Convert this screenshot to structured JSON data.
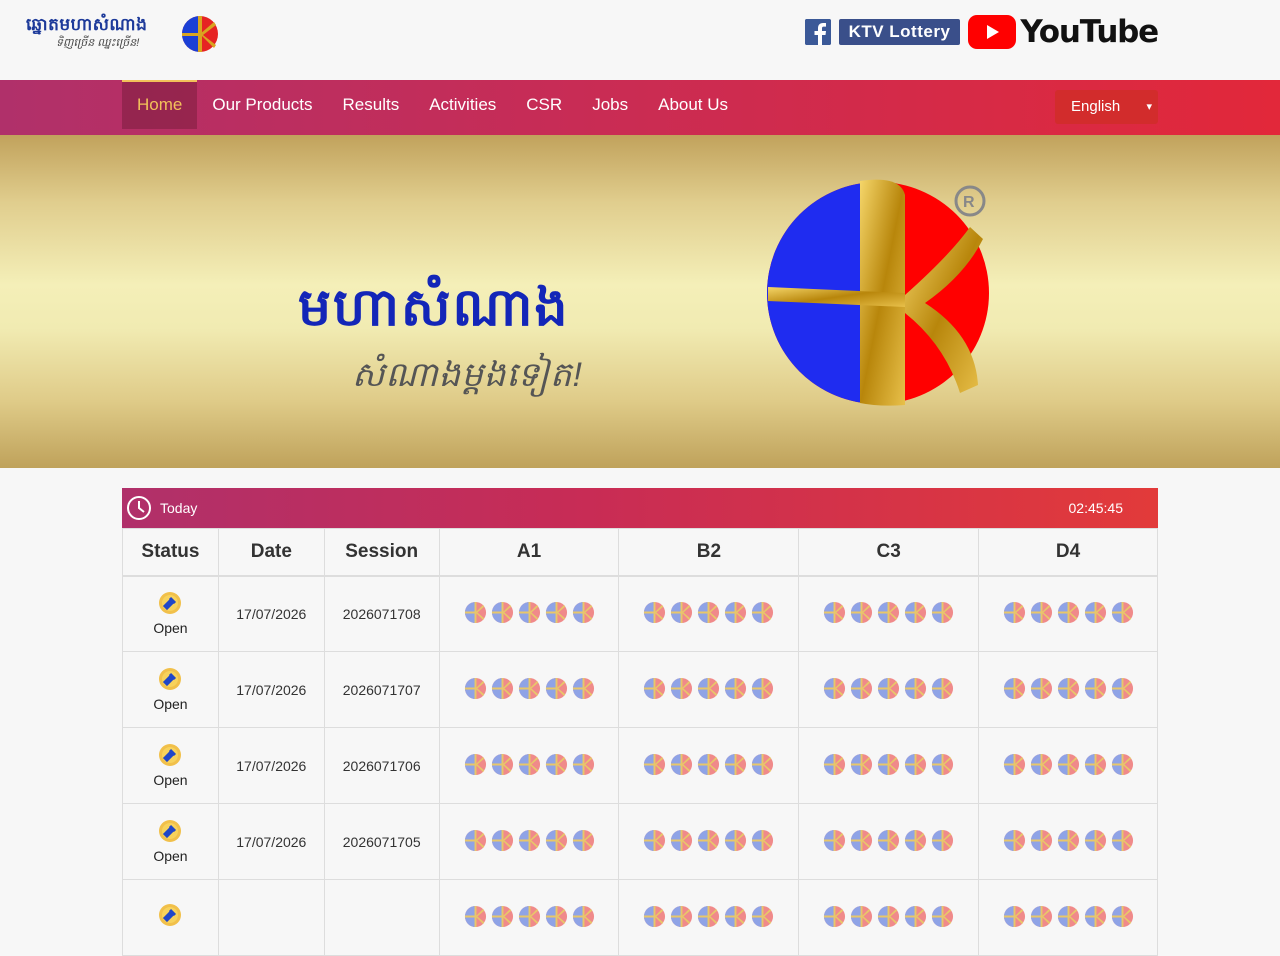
{
  "header": {
    "logo": {
      "title": "ឆ្នោតមហាសំណាង",
      "slogan": "ទិញច្រើន ឈ្នះច្រើន!"
    },
    "social": {
      "ktv_label": "KTV Lottery",
      "youtube_label": "YouTube"
    }
  },
  "nav": {
    "items": [
      {
        "label": "Home",
        "active": true
      },
      {
        "label": "Our Products"
      },
      {
        "label": "Results"
      },
      {
        "label": "Activities"
      },
      {
        "label": "CSR"
      },
      {
        "label": "Jobs"
      },
      {
        "label": "About Us"
      }
    ],
    "language": "English"
  },
  "banner": {
    "title": "មហាសំណាង",
    "slogan": "សំណាងម្តងទៀត!"
  },
  "results": {
    "header_label": "Today",
    "clock": "02:45:45",
    "columns": [
      "Status",
      "Date",
      "Session",
      "A1",
      "B2",
      "C3",
      "D4"
    ],
    "rows": [
      {
        "status": "Open",
        "date": "17/07/2026",
        "session": "2026071708"
      },
      {
        "status": "Open",
        "date": "17/07/2026",
        "session": "2026071707"
      },
      {
        "status": "Open",
        "date": "17/07/2026",
        "session": "2026071706"
      },
      {
        "status": "Open",
        "date": "17/07/2026",
        "session": "2026071705"
      },
      {
        "status": "",
        "date": "",
        "session": ""
      }
    ]
  },
  "colors": {
    "nav_start": "#b0306a",
    "nav_end": "#e2283a",
    "active": "#f2c15a",
    "brand_blue": "#1326b8"
  }
}
